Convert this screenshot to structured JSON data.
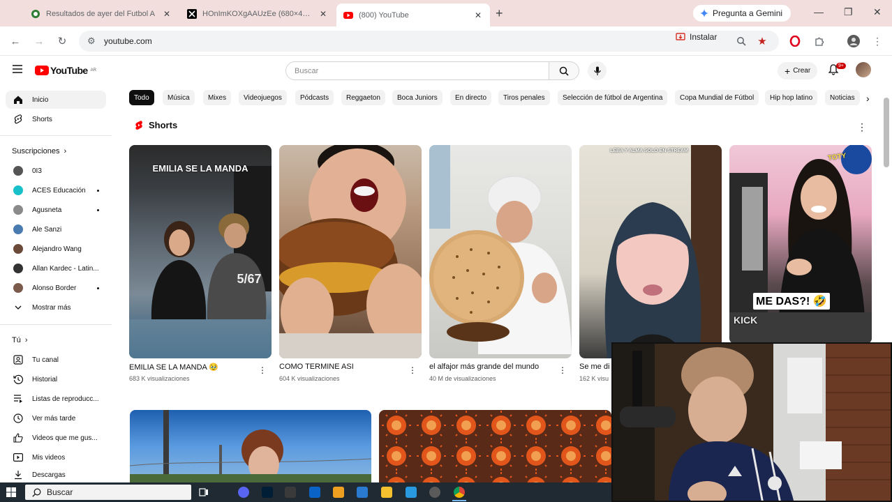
{
  "browser": {
    "tabs": [
      {
        "title": "Resultados de ayer del Futbol A",
        "close": "✕"
      },
      {
        "title": "HOnImKOXgAAUzEe (680×455)",
        "close": "✕"
      },
      {
        "title": "(800) YouTube",
        "close": "✕"
      }
    ],
    "new_tab": "+",
    "gemini_label": "Pregunta a Gemini",
    "url": "youtube.com",
    "install_label": "Instalar"
  },
  "youtube": {
    "logo_text": "YouTube",
    "country_code": "AR",
    "search_placeholder": "Buscar",
    "create_label": "Crear",
    "notifications_count": "9+",
    "sidebar": {
      "home": "Inicio",
      "shorts": "Shorts",
      "subscriptions_title": "Suscripciones",
      "subscriptions": [
        {
          "name": "0I3",
          "dot": false
        },
        {
          "name": "ACES Educación",
          "dot": true
        },
        {
          "name": "Agusneta",
          "dot": true
        },
        {
          "name": "Ale Sanzi",
          "dot": false
        },
        {
          "name": "Alejandro Wang",
          "dot": false
        },
        {
          "name": "Allan Kardec - Latin...",
          "dot": false
        },
        {
          "name": "Alonso Border",
          "dot": true
        }
      ],
      "show_more": "Mostrar más",
      "you_title": "Tú",
      "you_items": [
        "Tu canal",
        "Historial",
        "Listas de reproducc...",
        "Ver más tarde",
        "Videos que me gus...",
        "Mis videos",
        "Descargas"
      ]
    },
    "chips": [
      "Todo",
      "Música",
      "Mixes",
      "Videojuegos",
      "Pódcasts",
      "Reggaeton",
      "Boca Juniors",
      "En directo",
      "Tiros penales",
      "Selección de fútbol de Argentina",
      "Copa Mundial de Fútbol",
      "Hip hop latino",
      "Noticias"
    ],
    "shorts_title": "Shorts",
    "shorts": [
      {
        "title": "EMILIA SE LA MANDA 🥹",
        "views": "683 K visualizaciones",
        "overlay": "EMILIA SE LA MANDA"
      },
      {
        "title": "COMO TERMINE ASI",
        "views": "604 K visualizaciones",
        "overlay": ""
      },
      {
        "title": "el alfajor más grande del mundo",
        "views": "40 M de visualizaciones",
        "overlay": ""
      },
      {
        "title": "Se me di",
        "views": "162 K visu",
        "overlay": "LEBA Y ALMA SOLO EN STREAM"
      },
      {
        "title": "",
        "views": "",
        "overlay": "ME DAS?! 🤣"
      }
    ],
    "kick_label": "KICK",
    "toty_label": "TOTY"
  },
  "taskbar": {
    "search_placeholder": "Buscar"
  },
  "colors": {
    "yt_red": "#ff0000",
    "tab_strip": "#f2dfdd",
    "chip_active": "#0f0f0f",
    "taskbar": "#1f2a33"
  }
}
